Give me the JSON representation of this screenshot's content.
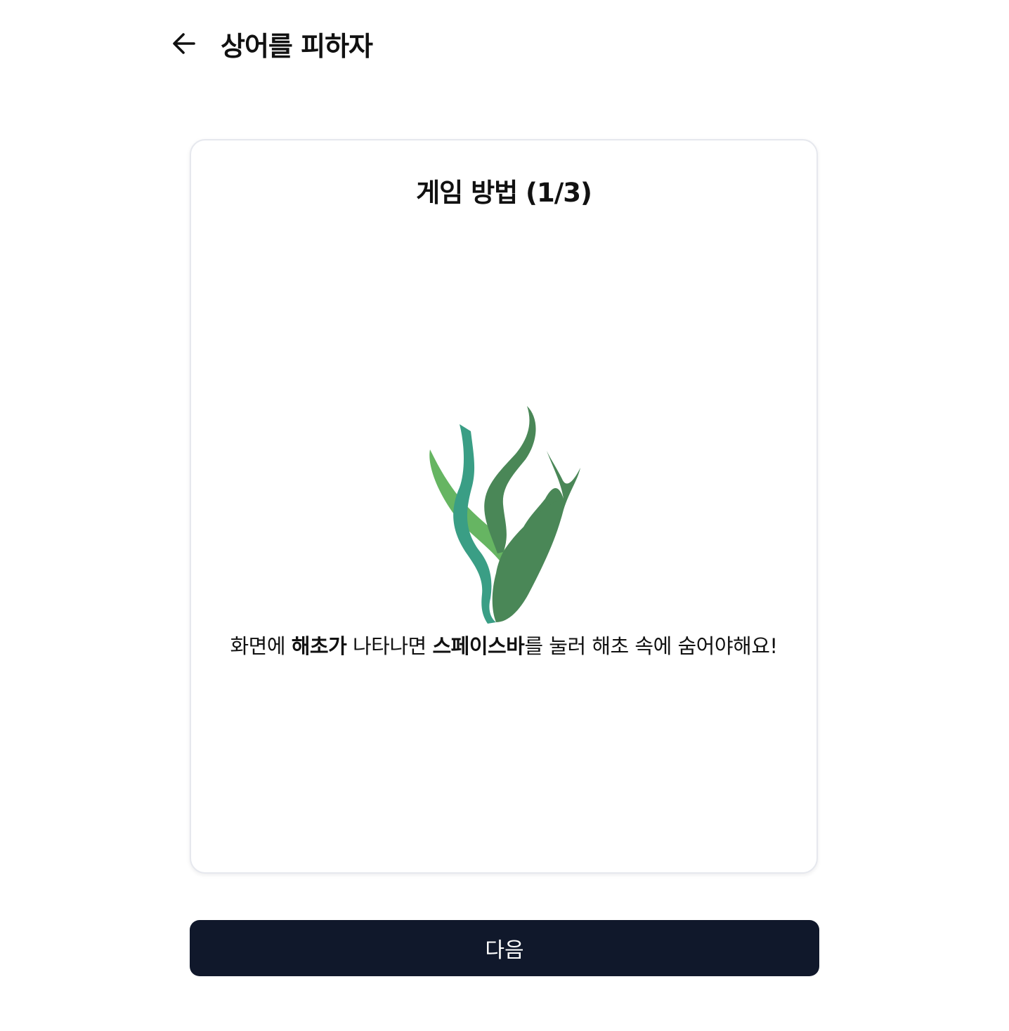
{
  "header": {
    "title": "상어를 피하자"
  },
  "card": {
    "title": "게임 방법 (1/3)",
    "instructions": {
      "part1": "화면에 ",
      "bold1": "해초가",
      "part2": " 나타나면 ",
      "bold2": "스페이스바",
      "part3": "를 눌러 해초 속에 숨어야해요!"
    },
    "illustration": {
      "icon": "seaweed-icon",
      "colors": [
        "#3a9e85",
        "#66b562",
        "#4a8757"
      ]
    }
  },
  "footer": {
    "next_label": "다음"
  },
  "colors": {
    "button_bg": "#10182b",
    "button_text": "#ffffff",
    "card_border": "#e6e8ee"
  }
}
